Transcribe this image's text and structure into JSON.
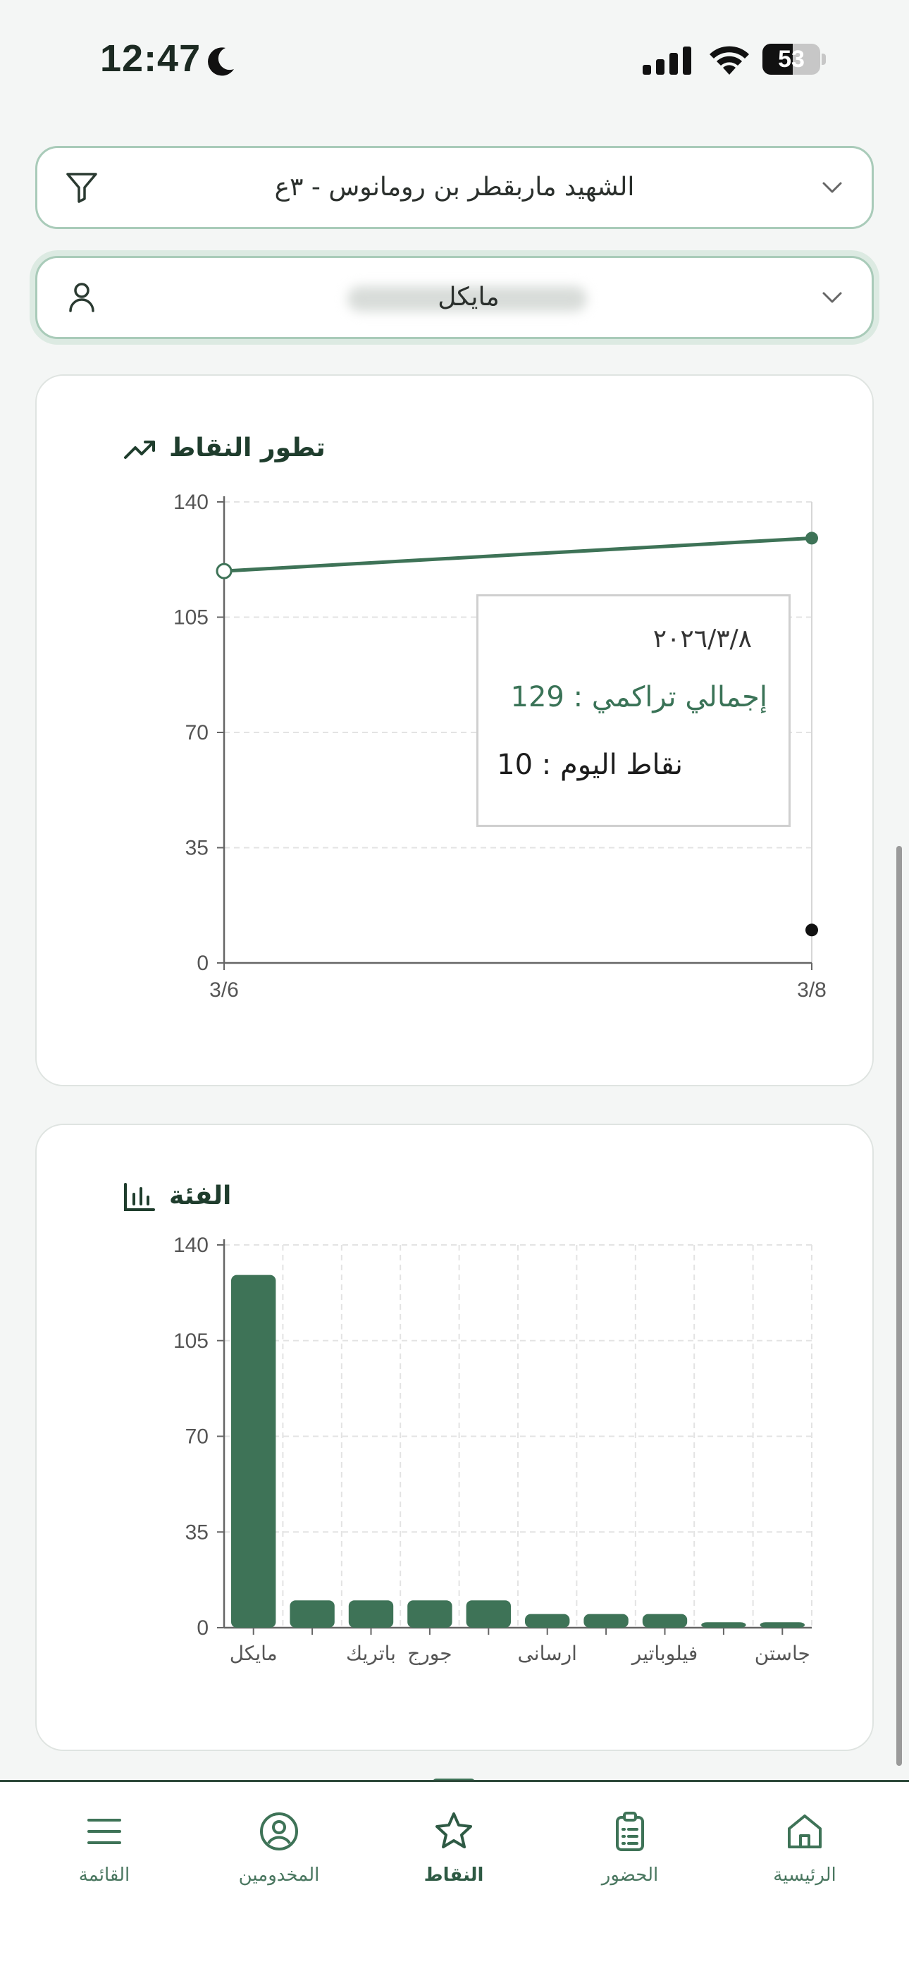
{
  "status_bar": {
    "time": "12:47",
    "battery_level": "53",
    "battery_fraction": 0.53
  },
  "filters": {
    "church": "الشهيد ماربقطر بن رومانوس - ٣ع",
    "person": "مايكل"
  },
  "points_card": {
    "title": "تطور النقاط",
    "icon": "trending-up-icon",
    "tooltip": {
      "date": "٢٠٢٦/٣/٨",
      "total_line": "إجمالي تراكمي : 129",
      "today_line": "نقاط اليوم : 10"
    }
  },
  "category_card": {
    "title": "الفئة",
    "icon": "bar-chart-icon"
  },
  "chart_data": [
    {
      "type": "line",
      "x": [
        "3/6",
        "3/8"
      ],
      "series": [
        {
          "name": "إجمالي تراكمي",
          "values": [
            119,
            129
          ],
          "color": "#3e7357"
        },
        {
          "name": "نقاط اليوم",
          "values": [
            null,
            10
          ],
          "color": "#111111"
        }
      ],
      "ylim": [
        0,
        140
      ],
      "yticks": [
        0,
        35,
        70,
        105,
        140
      ],
      "grid": true
    },
    {
      "type": "bar",
      "categories": [
        "مايكل",
        "",
        "باتريك",
        "جورج",
        "",
        "ارسانى",
        "",
        "فيلوباتير",
        "",
        "جاستن"
      ],
      "values": [
        129,
        10,
        10,
        10,
        10,
        5,
        5,
        5,
        2,
        2
      ],
      "color": "#3e7357",
      "ylim": [
        0,
        140
      ],
      "yticks": [
        0,
        35,
        70,
        105,
        140
      ],
      "grid": true
    }
  ],
  "bottom_nav": {
    "items": [
      {
        "label": "القائمة",
        "icon": "menu-icon"
      },
      {
        "label": "المخدومين",
        "icon": "user-circle-icon"
      },
      {
        "label": "النقاط",
        "icon": "star-icon",
        "active": true
      },
      {
        "label": "الحضور",
        "icon": "clipboard-icon"
      },
      {
        "label": "الرئيسية",
        "icon": "home-icon"
      }
    ]
  },
  "colors": {
    "accent": "#3e7357",
    "border": "#a9cbb9"
  }
}
